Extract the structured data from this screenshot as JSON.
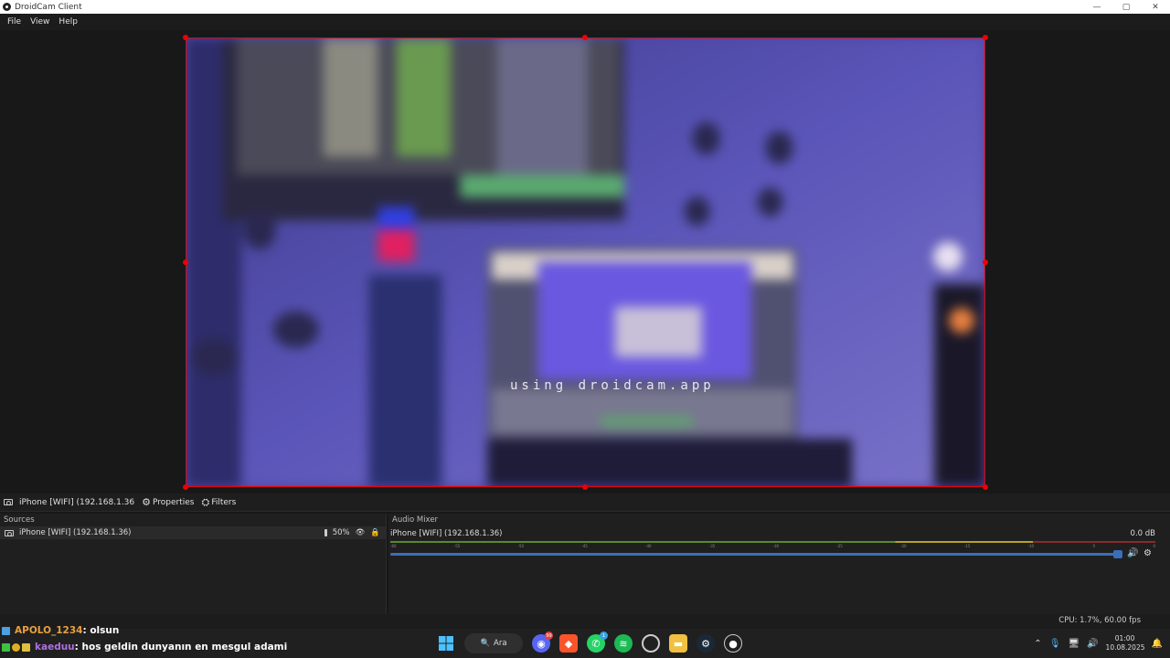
{
  "window": {
    "title": "DroidCam Client",
    "controls": {
      "minimize": "—",
      "maximize": "▢",
      "close": "✕"
    }
  },
  "menu": [
    "File",
    "View",
    "Help"
  ],
  "preview": {
    "watermark": "using droidcam.app"
  },
  "source_toolbar": {
    "source_name": "iPhone [WIFI] (192.168.1.36",
    "properties_label": "Properties",
    "filters_label": "Filters"
  },
  "sources": {
    "title": "Sources",
    "items": [
      {
        "name": "iPhone [WIFI] (192.168.1.36)",
        "volume": "50%"
      }
    ]
  },
  "audio_mixer": {
    "title": "Audio Mixer",
    "channel": "iPhone [WIFI] (192.168.1.36)",
    "db": "0.0 dB",
    "ticks": [
      "-60",
      "-55",
      "-50",
      "-45",
      "-40",
      "-35",
      "-30",
      "-25",
      "-20",
      "-15",
      "-10",
      "-5",
      "0"
    ]
  },
  "status": {
    "cpu": "CPU: 1.7%, 60.00 fps"
  },
  "chat": [
    {
      "user": "APOLO_1234",
      "message": ": olsun"
    },
    {
      "user": "kaeduu",
      "message": ": hos geldin dunyanın en mesgul adami"
    }
  ],
  "taskbar": {
    "search_label": "Ara",
    "discord_badge": "99",
    "whatsapp_badge": "1",
    "time": "01:00",
    "date": "10.08.2025"
  },
  "colors": {
    "selection": "#e00000",
    "fader": "#3a6fb8"
  }
}
